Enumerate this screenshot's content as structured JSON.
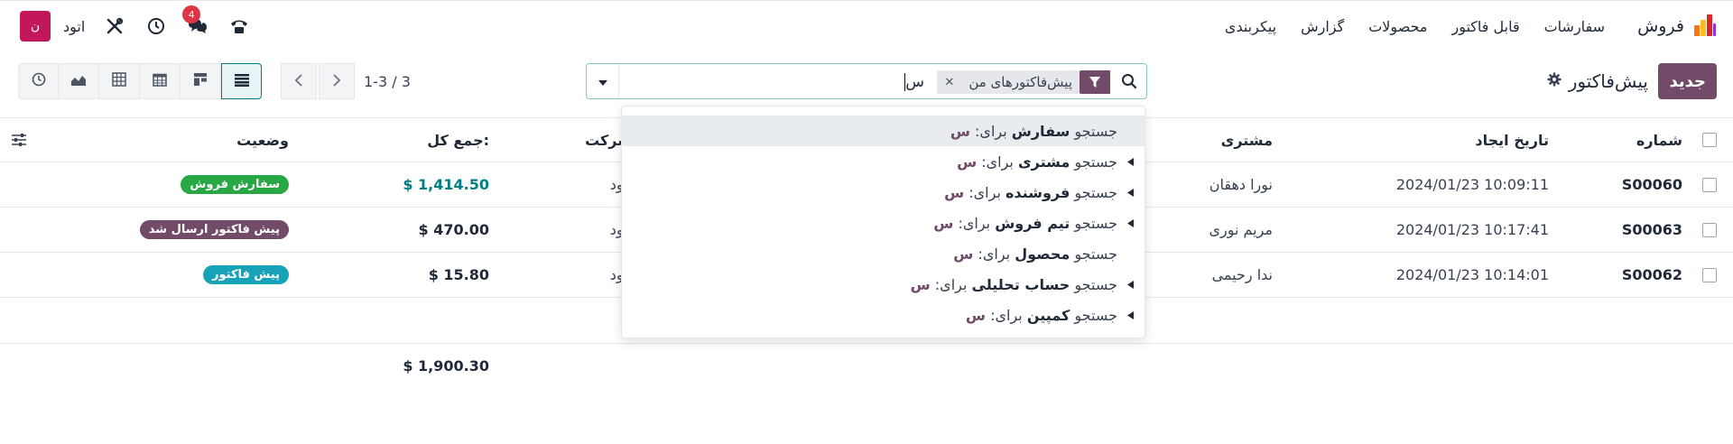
{
  "app": {
    "name": "فروش",
    "menu": [
      "سفارشات",
      "قابل فاکتور",
      "محصولات",
      "گزارش",
      "پیکربندی"
    ],
    "logo_colors": [
      "#f97316",
      "#fbbf24",
      "#dc2626",
      "#7c3aed"
    ]
  },
  "systray": {
    "avatar_letter": "ن",
    "company": "اتود",
    "message_badge": "4",
    "icons": [
      "phone-icon",
      "chat-icon",
      "clock-icon",
      "tools-icon"
    ]
  },
  "control_panel": {
    "new_button": "جدید",
    "breadcrumb_title": "پیش‌فاکتور",
    "search": {
      "facet_label": "پیش‌فاکتورهای من",
      "query": "س"
    },
    "pager": {
      "value": "1-3 / 3"
    },
    "views": [
      "activity",
      "graph",
      "pivot",
      "calendar",
      "kanban",
      "list"
    ],
    "active_view": "list"
  },
  "list": {
    "headers": {
      "number": "شماره",
      "date": "تاریخ ایجاد",
      "customer": "مشتری",
      "company": "شرکت",
      "total": "جمع کل:",
      "status": "وضعیت"
    },
    "rows": [
      {
        "number": "S00060",
        "date": "2024/01/23 10:09:11",
        "customer": "نورا دهقان",
        "company": "اتود",
        "total": "$ 1,414.50",
        "status": "سفارش فروش",
        "status_color": "#28a745",
        "total_link": true
      },
      {
        "number": "S00063",
        "date": "2024/01/23 10:17:41",
        "customer": "مریم نوری",
        "company": "اتود",
        "total": "$ 470.00",
        "status": "پیش فاکتور ارسال شد",
        "status_color": "#714b67",
        "total_link": false
      },
      {
        "number": "S00062",
        "date": "2024/01/23 10:14:01",
        "customer": "ندا رحیمی",
        "company": "اتود",
        "total": "$ 15.80",
        "status": "پیش فاکتور",
        "status_color": "#17a2b8",
        "total_link": false
      }
    ],
    "grand_total": "$ 1,900.30"
  },
  "dropdown": {
    "prefix": "جستجو",
    "for_label": "برای:",
    "query": "س",
    "items": [
      {
        "field": "سفارش",
        "expandable": false,
        "highlighted": true
      },
      {
        "field": "مشتری",
        "expandable": true,
        "highlighted": false
      },
      {
        "field": "فروشنده",
        "expandable": true,
        "highlighted": false
      },
      {
        "field": "تیم فروش",
        "expandable": true,
        "highlighted": false
      },
      {
        "field": "محصول",
        "expandable": false,
        "highlighted": false
      },
      {
        "field": "حساب تحلیلی",
        "expandable": true,
        "highlighted": false
      },
      {
        "field": "کمپین",
        "expandable": true,
        "highlighted": false
      }
    ]
  },
  "colors": {
    "brand": "#714b67",
    "accent": "#017e84"
  }
}
